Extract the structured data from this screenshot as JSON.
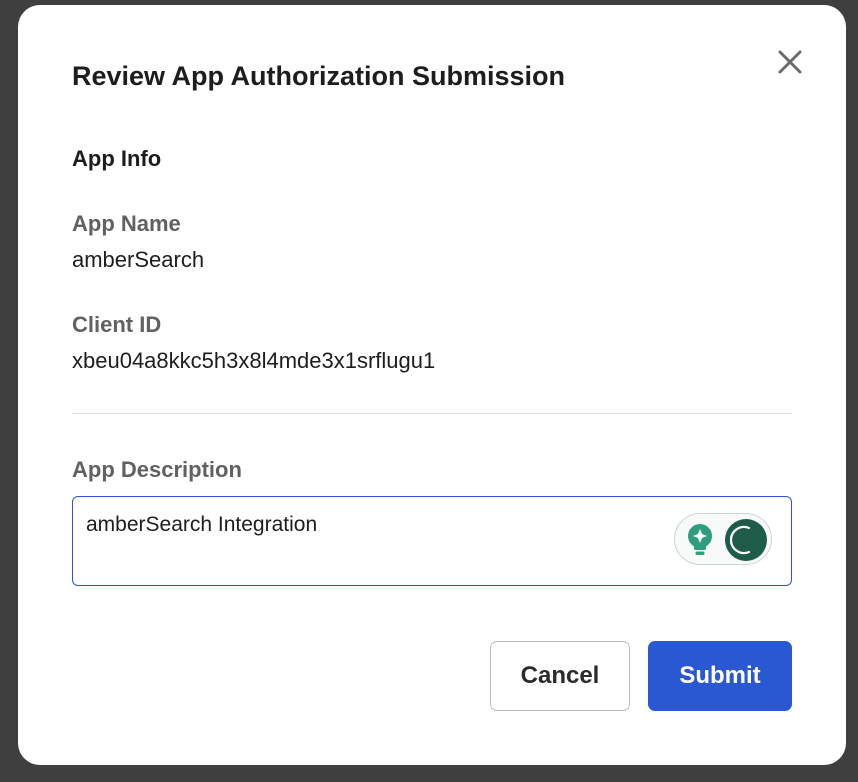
{
  "dialog": {
    "title": "Review App Authorization Submission",
    "close_icon": "close-icon"
  },
  "app_info": {
    "heading": "App Info",
    "name_label": "App Name",
    "name_value": "amberSearch",
    "client_id_label": "Client ID",
    "client_id_value": "xbeu04a8kkc5h3x8l4mde3x1srflugu1"
  },
  "description": {
    "label": "App Description",
    "value": "amberSearch Integration",
    "assistant_icons": [
      "lightbulb-sparkle-icon",
      "assistant-logo-icon"
    ]
  },
  "actions": {
    "cancel_label": "Cancel",
    "submit_label": "Submit"
  },
  "colors": {
    "primary": "#2a57d2",
    "focus_border": "#2c57d3",
    "label_gray": "#616161",
    "assistant_green": "#1e5b4a",
    "bulb_green": "#2e9e7e"
  }
}
